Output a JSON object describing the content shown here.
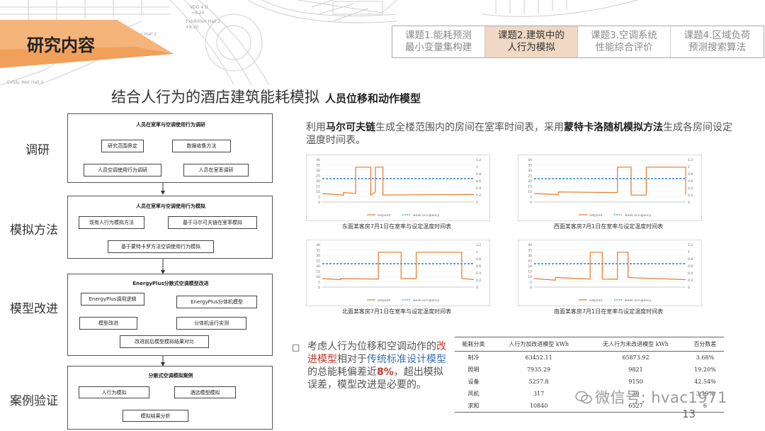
{
  "header": {
    "title": "研究内容",
    "tabs": [
      {
        "label": "课题1.能耗预测\n最小变量集构建",
        "active": false
      },
      {
        "label": "课题2.建筑中的\n人行为模拟",
        "active": true
      },
      {
        "label": "课题3.空调系统\n性能综合评价",
        "active": false
      },
      {
        "label": "课题4.区域负荷\n预测搜索算法",
        "active": false
      }
    ],
    "sketch_labels": [
      "VDO 4 D",
      "+6.20",
      "Exhibition Hall 3",
      "+8.20",
      "Exhibition Hall 2",
      "Exhib. Wet Hall 1"
    ]
  },
  "subtitle": {
    "main": "结合人行为的酒店建筑能耗模拟",
    "sub": "人员位移和动作模型"
  },
  "flow": {
    "stages": [
      "调研",
      "模拟方法",
      "模型改进",
      "案例验证"
    ],
    "box1": {
      "head": "人员在室率与空调使用行为调研",
      "n1": "研究范围界定",
      "n2": "数据收集方法",
      "n3": "人员空调使用行为调研",
      "n4": "人员在室率调研"
    },
    "box2": {
      "head": "人员在室率与空调使用行为模拟",
      "n1": "现有人行为模拟方法",
      "n2": "基于马尔可夫链在室率模拟",
      "n3": "基于蒙特卡罗方法空调使用行为模拟"
    },
    "box3": {
      "head": "EnergyPlus分散式空调模型改进",
      "n1": "EnergyPlus调用逻辑",
      "n2": "EnergyPlus分体机模型",
      "n3": "模型改进",
      "n4": "分体机运行实测",
      "n5": "改进前后模型模拟结果对比"
    },
    "box4": {
      "head": "分散式空调模拟案例",
      "n1": "人行为模拟",
      "n2": "酒店模型模拟",
      "n3": "模拟结果分析"
    }
  },
  "paragraph": {
    "p1": "利用",
    "b1": "马尔可夫链",
    "p2": "生成全楼范围内的房间在室率时间表，采用",
    "b2": "蒙特卡洛随机模拟方法",
    "p3": "生成各房间设定温度时间表。"
  },
  "charts": [
    {
      "caption": "东面某客房7月1日在室率与设定温度时间表",
      "legend_setpoint": "setpoint",
      "legend_occ": "week occupancy",
      "yleft": [
        "40",
        "35",
        "30",
        "25",
        "20",
        "15",
        "10",
        "5",
        "0"
      ],
      "yright": [
        "1.2",
        "1",
        "0.8",
        "0.6",
        "0.4",
        "0.2",
        "0"
      ]
    },
    {
      "caption": "西面某客房7月1日在室率与设定温度时间表",
      "legend_setpoint": "setpoint",
      "legend_occ": "week occupancy",
      "yleft": [
        "40",
        "35",
        "30",
        "25",
        "20",
        "15",
        "10",
        "5",
        "0"
      ],
      "yright": [
        "1.2",
        "1",
        "0.8",
        "0.6",
        "0.4",
        "0.2",
        "0"
      ]
    },
    {
      "caption": "北面某客房7月1日在室率与设定温度时间表",
      "legend_setpoint": "setpoint",
      "legend_occ": "week occupancy",
      "yleft": [
        "40",
        "35",
        "30",
        "25",
        "20",
        "15",
        "10",
        "5",
        "0"
      ],
      "yright": [
        "1.2",
        "1",
        "0.8",
        "0.6",
        "0.4",
        "0.2",
        "0"
      ]
    },
    {
      "caption": "南面某客房7月1日在室率与设定温度时间表",
      "legend_setpoint": "setpoint",
      "legend_occ": "week occupancy",
      "yleft": [
        "40",
        "35",
        "30",
        "25",
        "20",
        "15",
        "10",
        "5",
        "0"
      ],
      "yright": [
        "1.2",
        "1",
        "0.8",
        "0.6",
        "0.4",
        "0.2",
        "0"
      ]
    }
  ],
  "conclusion": {
    "bullet": "□",
    "t1": "考虑人行为位移和空调动作的",
    "red1": "改进模型",
    "t2": "相对于",
    "blue1": "传统标准设计模型",
    "t3": "的总能耗偏差近",
    "redb": "8%",
    "t4": "，超出模拟误差，模型改进是必要的。"
  },
  "table": {
    "headers": [
      "能耗分类",
      "人行为加改进模型 kWh",
      "无人行为未改进模型 kWh",
      "百分数差"
    ],
    "rows": [
      [
        "制冷",
        "63452.11",
        "65873.92",
        "3.68%"
      ],
      [
        "照明",
        "7935.29",
        "9821",
        "19.20%"
      ],
      [
        "设备",
        "5257.8",
        "9150",
        "42.54%"
      ],
      [
        "风机",
        "317",
        "30",
        "3.19%"
      ],
      [
        "求和",
        "10840",
        "6527",
        "6"
      ]
    ]
  },
  "watermark": "微信号: hvac1971",
  "page_number": "13",
  "colors": {
    "banner": "#f0a05a",
    "tab_active": "#f1d8c4",
    "setpoint": "#e07b2a",
    "occupancy": "#4a90d9"
  }
}
